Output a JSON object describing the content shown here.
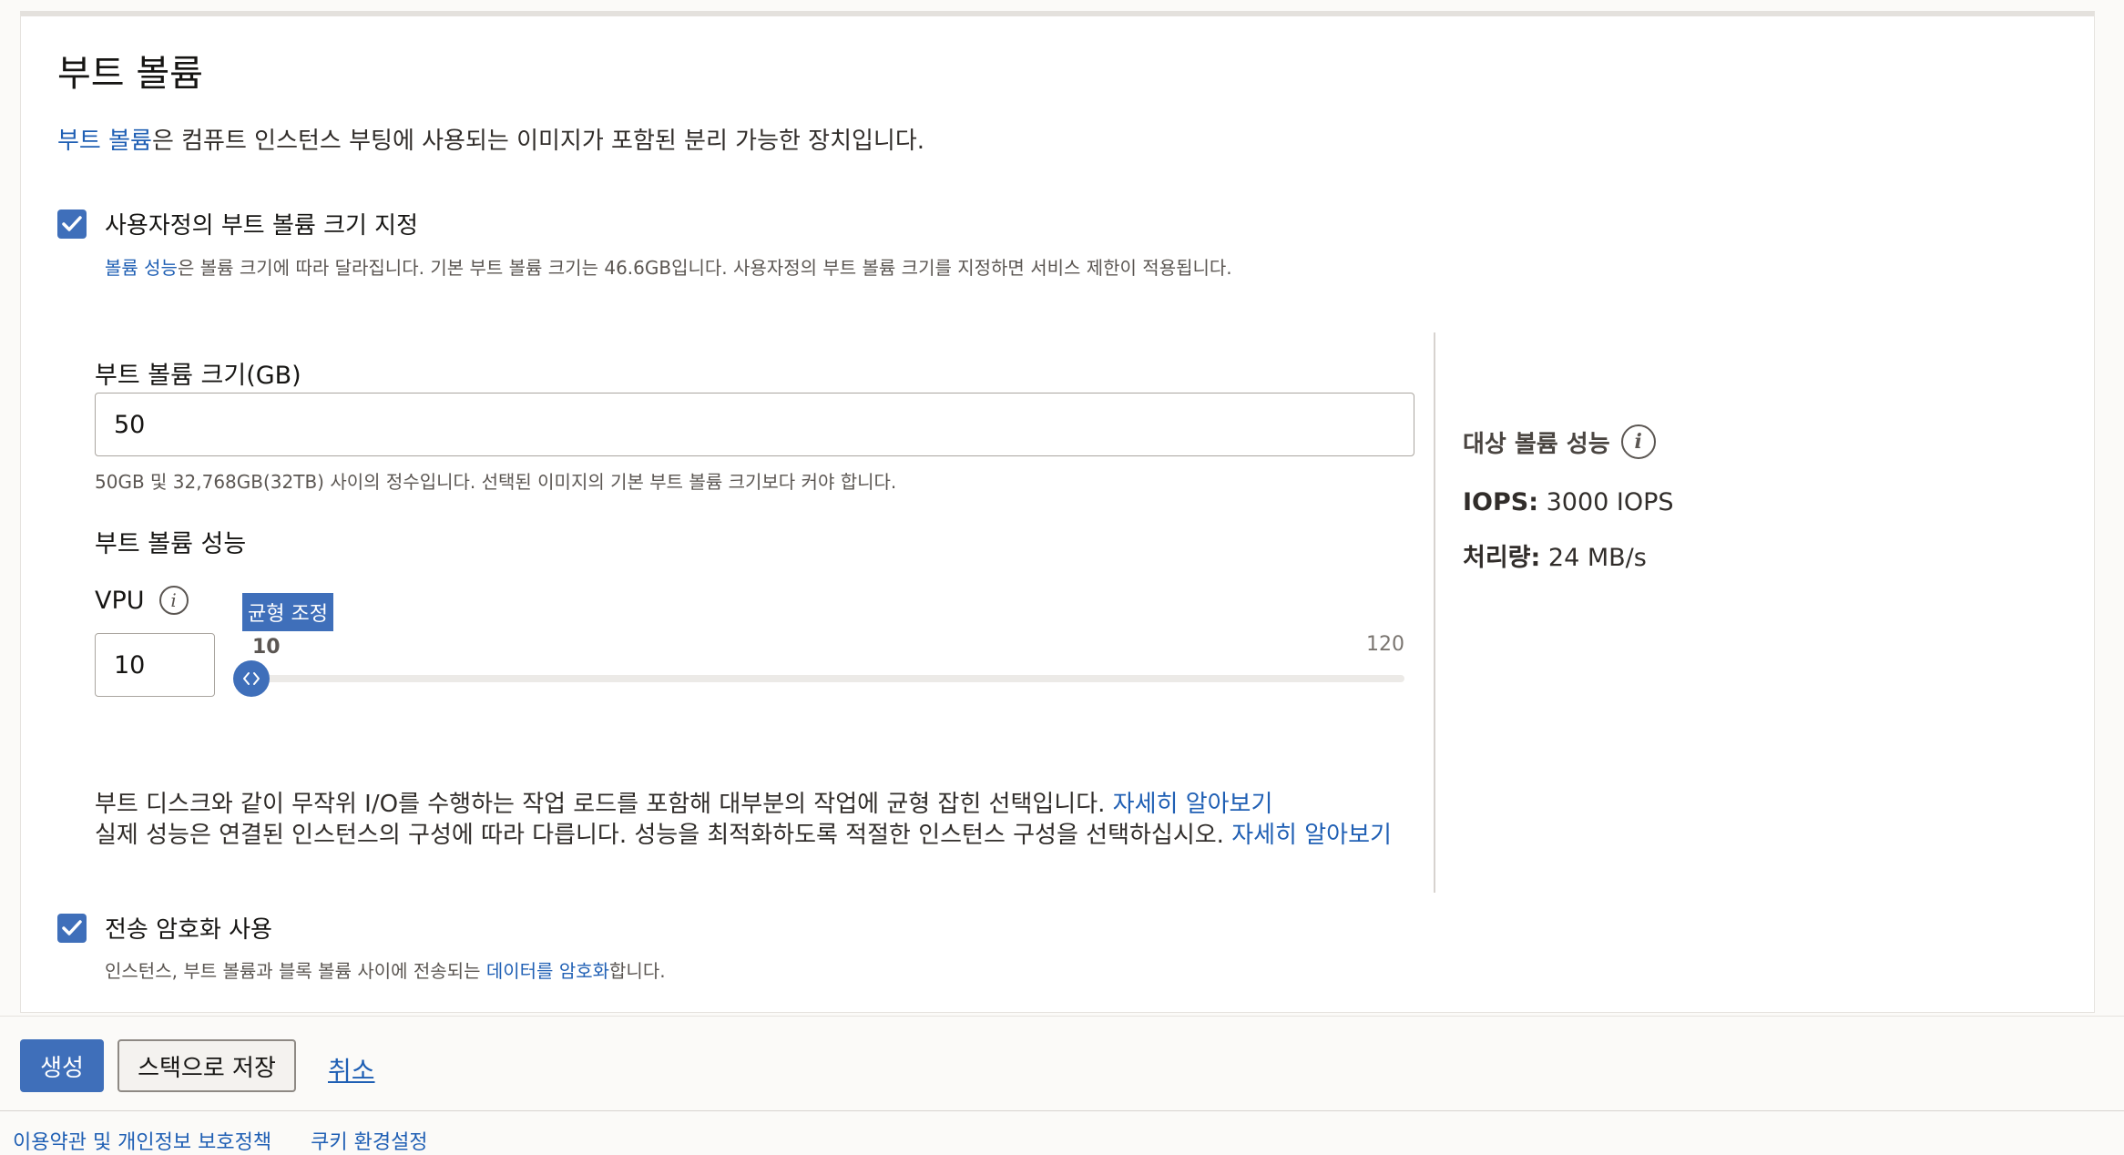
{
  "section": {
    "title": "부트 볼륨",
    "intro_link": "부트 볼륨",
    "intro_rest": "은 컴퓨트 인스턴스 부팅에 사용되는 이미지가 포함된 분리 가능한 장치입니다."
  },
  "custom_size": {
    "checked": true,
    "label": "사용자정의 부트 볼륨 크기 지정",
    "help_link": "볼륨 성능",
    "help_rest": "은 볼륨 크기에 따라 달라집니다. 기본 부트 볼륨 크기는 46.6GB입니다. 사용자정의 부트 볼륨 크기를 지정하면 서비스 제한이 적용됩니다."
  },
  "size_field": {
    "label": "부트 볼륨 크기(GB)",
    "value": "50",
    "help": "50GB 및 32,768GB(32TB) 사이의 정수입니다. 선택된 이미지의 기본 부트 볼륨 크기보다 커야 합니다."
  },
  "performance": {
    "label": "부트 볼륨 성능",
    "vpu_label": "VPU",
    "vpu_value": "10",
    "slider_tooltip": "균형 조정",
    "slider_min_label": "10",
    "slider_max_label": "120",
    "slider_min": 10,
    "slider_max": 120,
    "slider_value": 10,
    "desc_line1": "부트 디스크와 같이 무작위 I/O를 수행하는 작업 로드를 포함해 대부분의 작업에 균형 잡힌 선택입니다. ",
    "desc_link1": "자세히 알아보기",
    "desc_line2": "실제 성능은 연결된 인스턴스의 구성에 따라 다릅니다. 성능을 최적화하도록 적절한 인스턴스 구성을 선택하십시오. ",
    "desc_link2": "자세히 알아보기"
  },
  "target_performance": {
    "title": "대상 볼륨 성능",
    "iops_label": "IOPS:",
    "iops_value": "3000 IOPS",
    "throughput_label": "처리량:",
    "throughput_value": "24 MB/s"
  },
  "encryption": {
    "checked": true,
    "label": "전송 암호화 사용",
    "help_prefix": "인스턴스, 부트 볼륨과 블록 볼륨 사이에 전송되는 ",
    "help_link": "데이터를 암호화",
    "help_suffix": "합니다."
  },
  "footer": {
    "create_label": "생성",
    "save_stack_label": "스택으로 저장",
    "cancel_label": "취소"
  },
  "bottom_links": {
    "terms": "이용약관 및 개인정보 보호정책",
    "cookies": "쿠키 환경설정"
  },
  "colors": {
    "accent": "#3f6fba",
    "link": "#1f5fb4"
  },
  "icons": {
    "checkbox": "check-icon",
    "info": "info-icon",
    "slider_thumb": "slider-handle-icon"
  }
}
